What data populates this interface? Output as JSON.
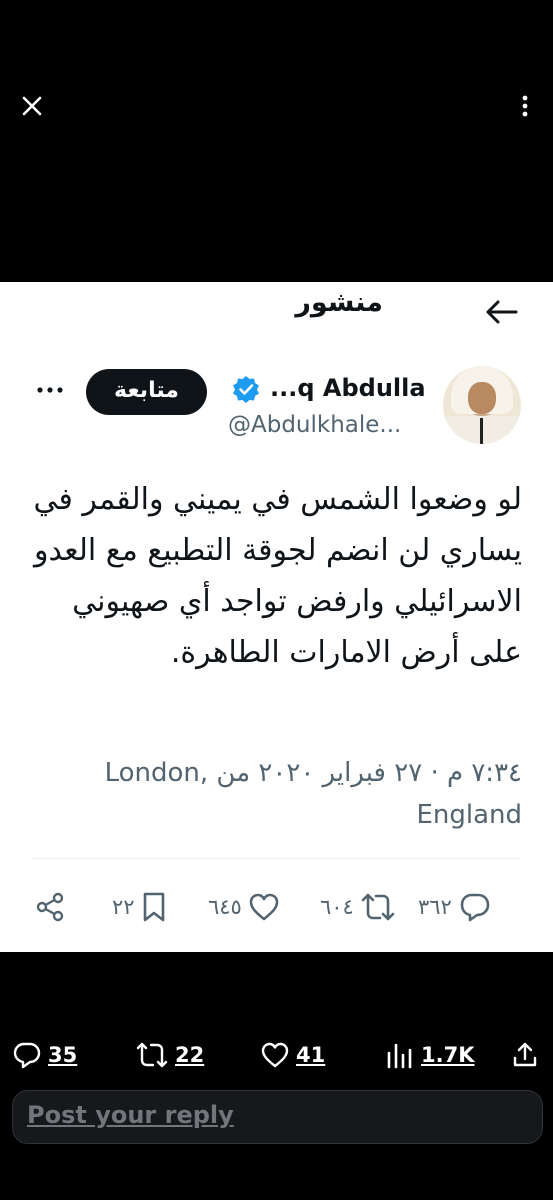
{
  "top": {
    "close_icon": "close-icon",
    "more_icon": "more-icon"
  },
  "header": {
    "title": "منشور",
    "back_icon": "arrow-right-icon"
  },
  "author": {
    "display_name": "...q Abdulla",
    "handle": "@Abdulkhale...",
    "follow_label": "متابعة"
  },
  "tweet": {
    "text": "لو وضعوا الشمس في يميني والقمر في يساري لن انضم لجوقة التطبيع مع العدو الاسرائيلي وارفض تواجد أي صهيوني على أرض الامارات الطاهرة.",
    "meta": "٧:٣٤ م · ٢٧ فبراير ٢٠٢٠ من London, England"
  },
  "actions": {
    "replies": "٣٦٢",
    "retweets": "٦٠٤",
    "likes": "٦٤٥",
    "bookmarks": "٢٢"
  },
  "stats": {
    "comments": "35",
    "reposts": "22",
    "likes": "41",
    "views": "1.7K"
  },
  "reply": {
    "placeholder": "Post your reply"
  },
  "colors": {
    "text": "#0f1419",
    "muted": "#536471",
    "verified": "#1d9bf0",
    "background": "#000000"
  }
}
